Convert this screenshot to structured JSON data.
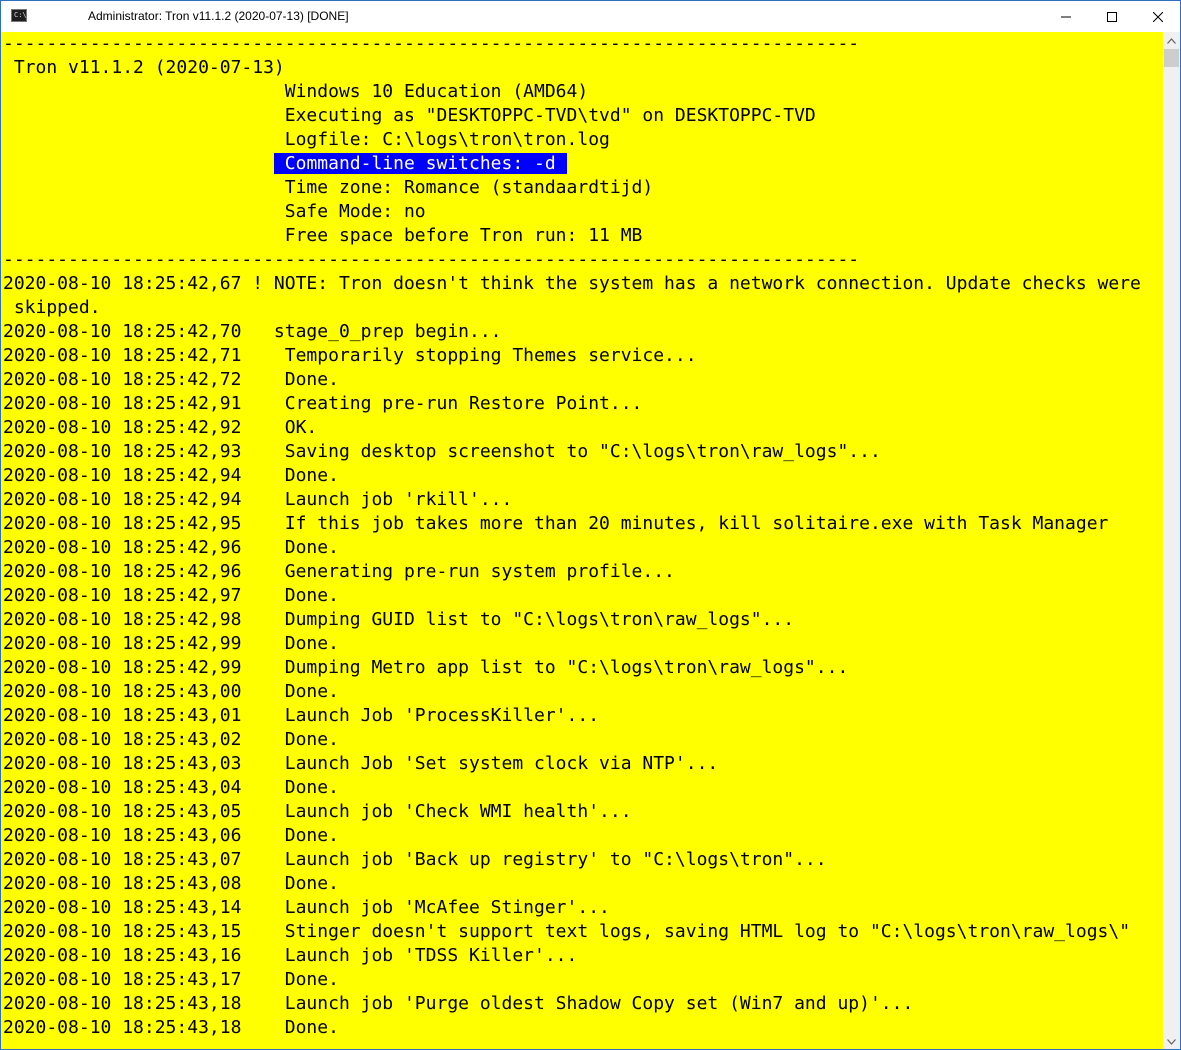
{
  "window": {
    "title": "Administrator:  Tron v11.1.2 (2020-07-13) [DONE]",
    "icon": "console-icon",
    "icon_glyph": "C:\\",
    "controls": [
      "minimize-icon",
      "maximize-icon",
      "close-icon"
    ]
  },
  "colors": {
    "background": "#ffff00",
    "text": "#000000",
    "highlight_bg": "#0000ff",
    "highlight_fg": "#ffffff"
  },
  "console": {
    "header": {
      "separator_top": "-------------------------------------------------------------------------------",
      "title": " Tron v11.1.2 (2020-07-13)",
      "os": "                          Windows 10 Education (AMD64)",
      "executing_as": "                          Executing as \"DESKTOPPC-TVD\\tvd\" on DESKTOPPC-TVD",
      "logfile": "                          Logfile: C:\\logs\\tron\\tron.log",
      "switches_indent": "                         ",
      "switches": " Command-line switches: -d ",
      "timezone": "                          Time zone: Romance (standaardtijd)",
      "safe_mode": "                          Safe Mode: no",
      "free_space": "                          Free space before Tron run: 11 MB",
      "separator_bottom": "-------------------------------------------------------------------------------"
    },
    "log_lines": [
      "2020-08-10 18:25:42,67 ! NOTE: Tron doesn't think the system has a network connection. Update checks were",
      " skipped.",
      "2020-08-10 18:25:42,70   stage_0_prep begin...",
      "2020-08-10 18:25:42,71    Temporarily stopping Themes service...",
      "2020-08-10 18:25:42,72    Done.",
      "2020-08-10 18:25:42,91    Creating pre-run Restore Point...",
      "2020-08-10 18:25:42,92    OK.",
      "2020-08-10 18:25:42,93    Saving desktop screenshot to \"C:\\logs\\tron\\raw_logs\"...",
      "2020-08-10 18:25:42,94    Done.",
      "2020-08-10 18:25:42,94    Launch job 'rkill'...",
      "2020-08-10 18:25:42,95    If this job takes more than 20 minutes, kill solitaire.exe with Task Manager",
      "2020-08-10 18:25:42,96    Done.",
      "2020-08-10 18:25:42,96    Generating pre-run system profile...",
      "2020-08-10 18:25:42,97    Done.",
      "2020-08-10 18:25:42,98    Dumping GUID list to \"C:\\logs\\tron\\raw_logs\"...",
      "2020-08-10 18:25:42,99    Done.",
      "2020-08-10 18:25:42,99    Dumping Metro app list to \"C:\\logs\\tron\\raw_logs\"...",
      "2020-08-10 18:25:43,00    Done.",
      "2020-08-10 18:25:43,01    Launch Job 'ProcessKiller'...",
      "2020-08-10 18:25:43,02    Done.",
      "2020-08-10 18:25:43,03    Launch Job 'Set system clock via NTP'...",
      "2020-08-10 18:25:43,04    Done.",
      "2020-08-10 18:25:43,05    Launch job 'Check WMI health'...",
      "2020-08-10 18:25:43,06    Done.",
      "2020-08-10 18:25:43,07    Launch job 'Back up registry' to \"C:\\logs\\tron\"...",
      "2020-08-10 18:25:43,08    Done.",
      "2020-08-10 18:25:43,14    Launch job 'McAfee Stinger'...",
      "2020-08-10 18:25:43,15    Stinger doesn't support text logs, saving HTML log to \"C:\\logs\\tron\\raw_logs\\\"",
      "2020-08-10 18:25:43,16    Launch job 'TDSS Killer'...",
      "2020-08-10 18:25:43,17    Done.",
      "2020-08-10 18:25:43,18    Launch job 'Purge oldest Shadow Copy set (Win7 and up)'...",
      "2020-08-10 18:25:43,18    Done."
    ]
  }
}
